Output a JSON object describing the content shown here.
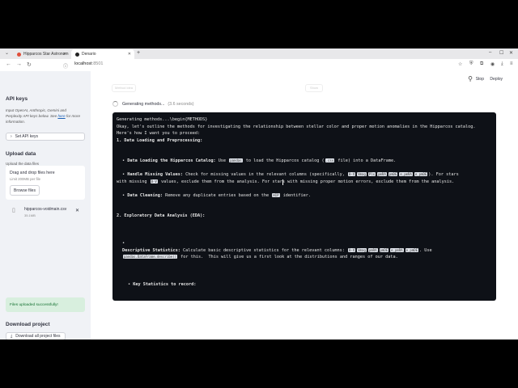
{
  "browser": {
    "tabs": [
      {
        "title": "Hipparcos Star Astronom",
        "active": false
      },
      {
        "title": "Denario",
        "active": true
      }
    ],
    "url_host": "localhost",
    "url_port": ":8501"
  },
  "sidebar": {
    "api_keys_heading": "API keys",
    "api_keys_desc_1": "Input OpenAI, Anthropic, Gemini and",
    "api_keys_desc_2": "Perplexity API keys below. See",
    "api_keys_link": "here",
    "api_keys_desc_3": "for more",
    "api_keys_desc_4": "information.",
    "set_api_keys_label": "Set API keys",
    "upload_heading": "Upload data",
    "upload_label": "Upload the data files",
    "drop_title": "Drag and drop files here",
    "drop_limit": "Limit 200MB per file",
    "browse_label": "Browse files",
    "file_name": "hipparcos-voidmain.csv",
    "file_size": "35.1MB",
    "success_message": "Files uploaded successfully!",
    "download_heading": "Download project",
    "download_label": "Download all project files"
  },
  "main": {
    "stop_label": "Stop",
    "deploy_label": "Deploy",
    "ghost_btn_1": "Method idea",
    "ghost_btn_2": "Show",
    "status_text": "Generating methods...",
    "status_time": "(3.6 seconds)",
    "code": {
      "l1": "Generating methods...\\begin{METHODS}",
      "l2": "Okay, let's outline the methods for investigating the relationship between stellar color and proper motion anomalies in the Hipparcos catalog.",
      "l3": "Here's how I want you to proceed:",
      "l4": "1. Data Loading and Preprocessing:",
      "b1_title": "Data Loading the Hipparcos Catalog:",
      "b1_a": "Use",
      "b1_code1": "pandas",
      "b1_b": "to load the Hipparcos catalog (",
      "b1_code2": ".csv",
      "b1_c": "file) into a DataFrame.",
      "b2_title": "Handle Missing Values:",
      "b2_a": "Check for missing values in the relevant columns (specifically,",
      "b2_c1": "B-V",
      "b2_c2": "Vmag",
      "b2_c3": "Plx",
      "b2_c4": "pmRA",
      "b2_c5": "pmDE",
      "b2_c6": "e_pmRA",
      "b2_c7": "e_pmDE",
      "b2_b": "). For stars",
      "b2_l2a": "with missing",
      "b2_c8": "B-V",
      "b2_l2b": "values, exclude them from the analysis. For stars with missing proper motion errors, exclude them from the analysis.",
      "b3_title": "Data Cleaning:",
      "b3_a": "Remove any duplicate entries based on the",
      "b3_code": "HIP",
      "b3_b": "identifier.",
      "l5": "2. Exploratory Data Analysis (EDA):",
      "bullet_marker": "•",
      "b4_title": "Descriptive Statistics:",
      "b4_a": "Calculate basic descriptive statistics for the relevant columns:",
      "b4_c1": "B-V",
      "b4_c2": "Vmag",
      "b4_c3": "pmRA",
      "b4_c4": "pmDE",
      "b4_c5": "e_pmRA",
      "b4_c6": "e_pmDE",
      "b4_b": ". Use",
      "b4_code2": "pandas.DataFrame.describe()",
      "b4_c": "for this.  This will give us a first look at the distributions and ranges of our data.",
      "b5_title": "Key Statistics to record:"
    }
  }
}
